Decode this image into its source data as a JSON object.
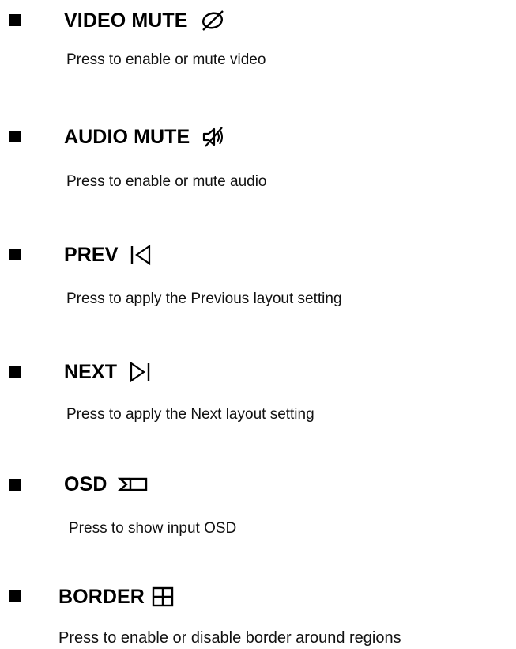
{
  "items": [
    {
      "label": "VIDEO MUTE",
      "icon": "video-mute-icon",
      "description": "Press to enable or mute video"
    },
    {
      "label": "AUDIO MUTE",
      "icon": "audio-mute-icon",
      "description": "Press to enable or mute audio"
    },
    {
      "label": "PREV",
      "icon": "previous-icon",
      "description": "Press to apply the Previous layout setting"
    },
    {
      "label": "NEXT",
      "icon": "next-icon",
      "description": "Press to apply the Next layout setting"
    },
    {
      "label": "OSD",
      "icon": "osd-icon",
      "description": "Press to show input OSD"
    },
    {
      "label": "BORDER",
      "icon": "border-icon",
      "description": "Press to enable or disable border around regions"
    }
  ],
  "colors": {
    "text": "#000000",
    "background": "#ffffff"
  }
}
